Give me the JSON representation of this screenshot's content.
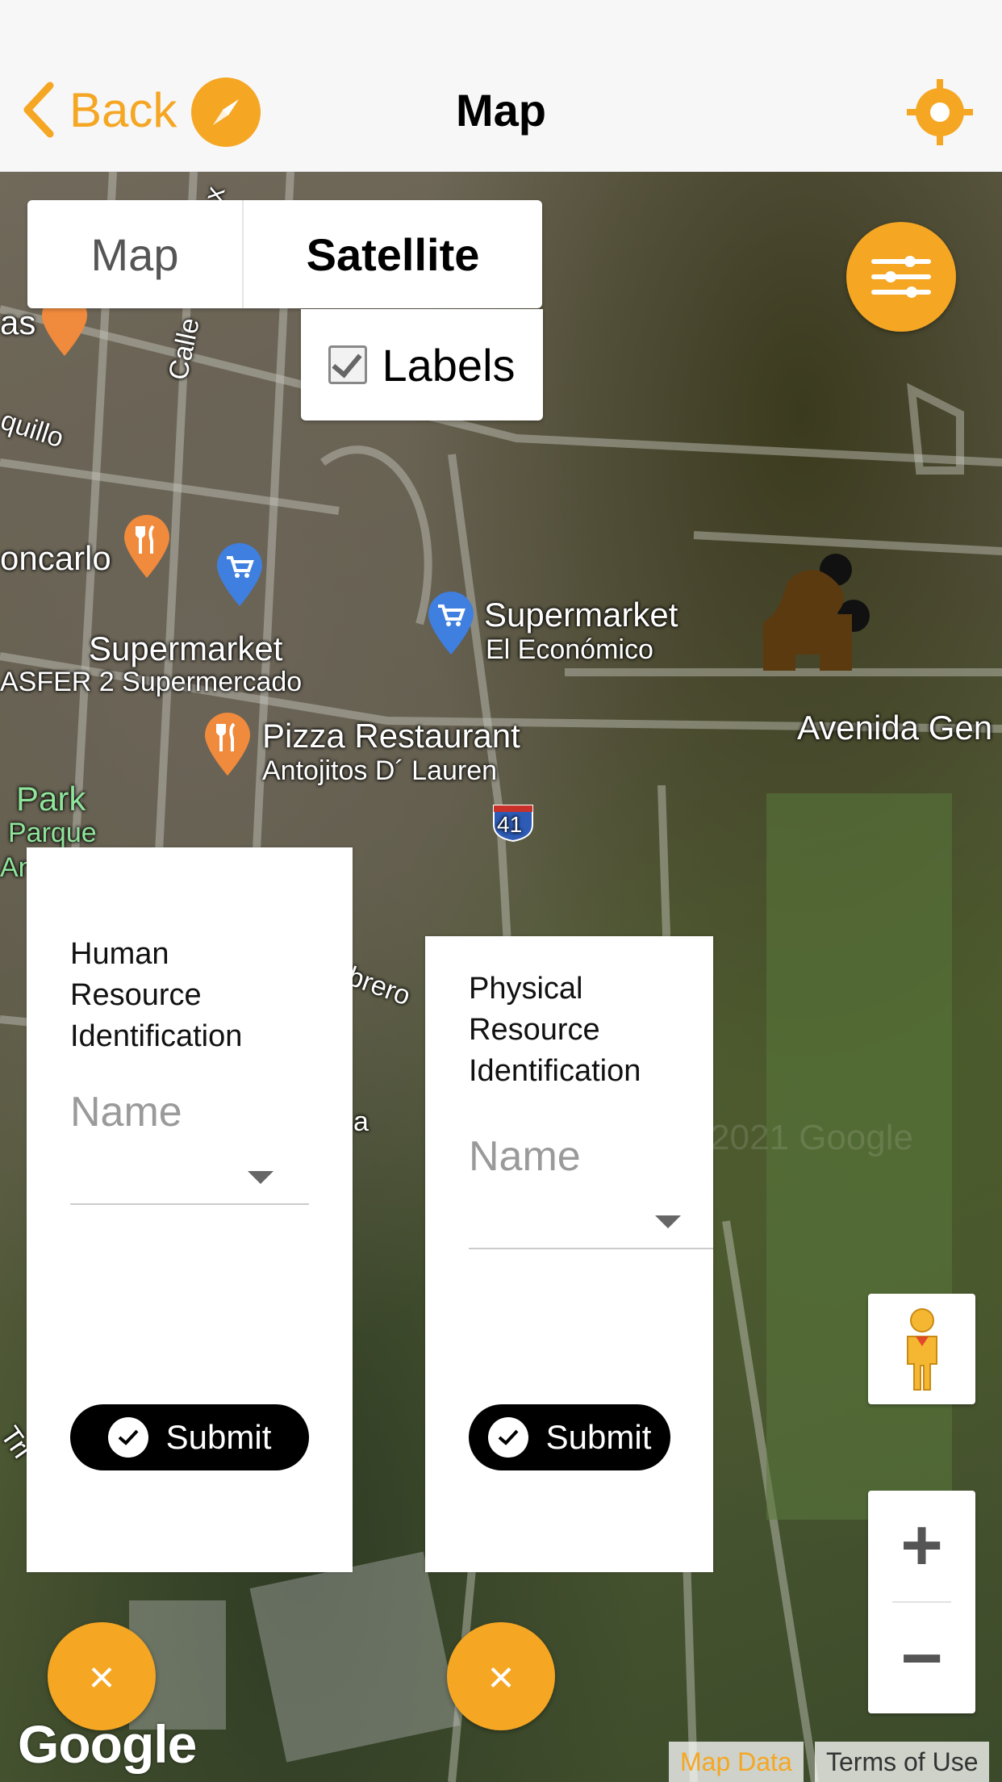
{
  "nav": {
    "back_label": "Back",
    "title": "Map",
    "compass_icon": "compass-icon",
    "locate_icon": "locate-icon",
    "accent": "#f5a623"
  },
  "map_type": {
    "options": [
      "Map",
      "Satellite"
    ],
    "selected": "Satellite",
    "labels_option": "Labels",
    "labels_checked": true
  },
  "map_labels": {
    "supermarket_1": "Supermarket",
    "supermarket_1_sub": "El Económico",
    "supermarket_2": "Supermarket",
    "supermarket_2_sub": "ASFER 2 Supermercado",
    "pizza": "Pizza Restaurant",
    "pizza_sub": "Antojitos D´ Lauren",
    "avenida": "Avenida Gen",
    "park": "Park",
    "park_sub": "Parque",
    "park_sub2": "An",
    "restaurant_left": "oncarlo",
    "street_calle": "Calle",
    "street_quillo": "quillo",
    "street_as": "as",
    "street_brero": "brero",
    "street_a": "a",
    "street_tri": "Tri",
    "street_x": "x",
    "highway": "41",
    "watermark": "2021 Google"
  },
  "human_card": {
    "title_1": "Human",
    "title_2": "Resource",
    "title_3": "Identification",
    "name_placeholder": "Name",
    "submit": "Submit"
  },
  "physical_card": {
    "title_1": "Physical",
    "title_2": "Resource",
    "title_3": "Identification",
    "name_placeholder": "Name",
    "submit": "Submit"
  },
  "controls": {
    "zoom_in": "+",
    "zoom_out": "−",
    "close_symbol": "×"
  },
  "footer": {
    "google": "Google",
    "map_data": "Map Data",
    "terms": "Terms of Use"
  }
}
